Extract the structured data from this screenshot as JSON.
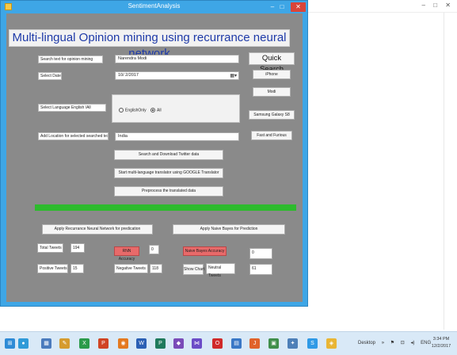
{
  "window": {
    "title": "SentimentAnalysis",
    "min": "–",
    "max": "□",
    "close": "✕"
  },
  "bg_window": {
    "min": "–",
    "max": "□",
    "close": "✕"
  },
  "heading": "Multi-lingual Opinion mining using recurrance neural network",
  "search": {
    "label": "Search text for opinion mining",
    "value": "Narendra Modi"
  },
  "date": {
    "label": "Select Date",
    "value": "10/ 2/2017"
  },
  "language": {
    "label": "Select Language English /All",
    "option_english": "EnglishOnly",
    "option_all": "All",
    "selected": "All"
  },
  "location": {
    "label": "Add Location for selected searched text",
    "value": "India"
  },
  "quick_search": {
    "title": "Quick Search",
    "items": [
      "iPhone",
      "Modi",
      "Samsung Galaxy S8",
      "Fast and Furious"
    ]
  },
  "actions": {
    "download": "Search and Download Twitter data",
    "translate": "Start multi-language translator using GOOGLE Translator",
    "preprocess": "Preprocess the translated data"
  },
  "progress": {
    "value": 1.0,
    "color": "#2dbb2d"
  },
  "predict": {
    "rnn_button": "Apply Recurrance Neural Network for predication",
    "bayes_button": "Apply Naive Bayes for Prediction"
  },
  "stats": {
    "total_label": "Total Tweets",
    "total_value": "194",
    "positive_label": "Positive Tweets",
    "positive_value": "15",
    "rnn_accuracy_label": "RNN Accuracy",
    "rnn_accuracy_value": "0",
    "negative_label": "Negative Tweets",
    "negative_value": "118",
    "bayes_accuracy_label": "Naive Bayes Accuracy",
    "bayes_accuracy_value": "0",
    "show_chart": "Show Chart",
    "neutral_label": "Neutral Tweets",
    "neutral_value": "61"
  },
  "taskbar": {
    "icons": [
      "start-icon",
      "chrome-icon",
      "file-explorer-icon",
      "paint-icon",
      "excel-icon",
      "powerpoint-icon",
      "firefox-icon",
      "word-icon",
      "publisher-icon",
      "visual-studio-icon",
      "app-icon",
      "opera-icon",
      "notepad-icon",
      "java-icon",
      "lock-icon",
      "settings-icon",
      "skype-icon",
      "sentiment-app-icon"
    ],
    "tray_desktop": "Desktop",
    "tray_lang": "ENG",
    "time": "3:34 PM",
    "date": "12/2/2017"
  }
}
